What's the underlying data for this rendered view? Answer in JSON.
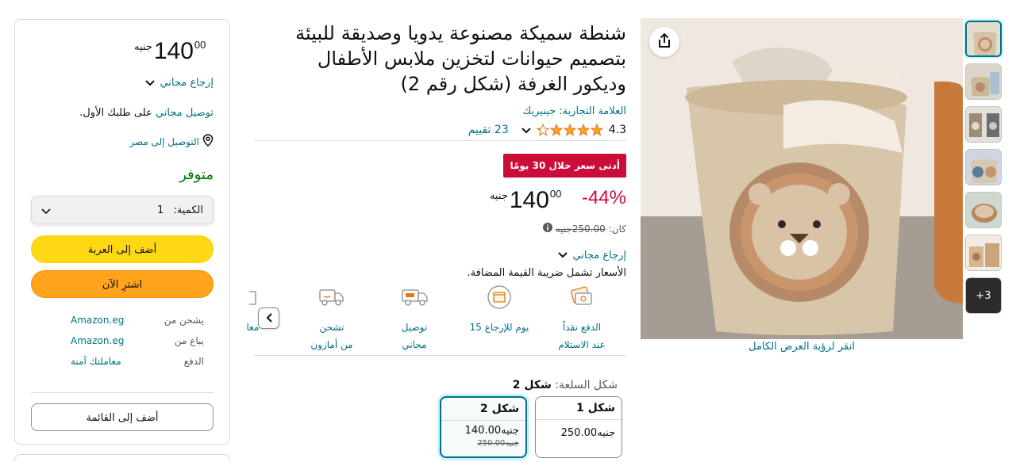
{
  "buybox": {
    "price": {
      "whole": "140",
      "fraction": "00",
      "currency": "جنيه"
    },
    "free_returns": "إرجاع مجاني",
    "free_delivery": {
      "link": "توصيل مجاني",
      "rest": "على طلبك الأول."
    },
    "deliver_to": "التوصيل إلى مصر",
    "availability": "متوفر",
    "quantity": {
      "label": "الكمية:",
      "value": "1"
    },
    "add_to_cart": "أضف إلى العربة",
    "buy_now": "اشترِ الآن",
    "ships_from": {
      "label": "يشحن من",
      "value": "Amazon.eg"
    },
    "sold_by": {
      "label": "يباع من",
      "value": "Amazon.eg"
    },
    "payment": {
      "label": "الدفع",
      "value": "معاملتك آمنة"
    },
    "add_to_list": "أضف إلى القائمة"
  },
  "product": {
    "title_lines": [
      "شنطة سميكة مصنوعة يدويا وصديقة للبيئة",
      "بتصميم حيوانات لتخزين ملابس الأطفال",
      "وديكور الغرفة (شكل رقم 2)"
    ],
    "brand": "العلامة التجارية: جينيريك",
    "rating": "4.3",
    "rating_stars": 4.3,
    "reviews": "23 تقييم",
    "deal_badge": "أدنى سعر خلال 30 يومًا",
    "discount": "-44%",
    "price": {
      "whole": "140",
      "fraction": "00",
      "currency": "جنيه"
    },
    "was": {
      "label": "كان:",
      "value": "250.00جنيه"
    },
    "free_returns": "إرجاع مجاني",
    "vat_note": ".الأسعار تشمل ضريبة القيمة المضافة",
    "features": [
      {
        "line1": "الدفع نقداً",
        "line2": "عند الاستلام"
      },
      {
        "line1": "15 يوم للإرجاع",
        "line2": ""
      },
      {
        "line1": "توصيل",
        "line2": "مجاني"
      },
      {
        "line1": "تشحن",
        "line2": "من أمازون"
      },
      {
        "line1": "معاملة",
        "line2": ""
      }
    ],
    "variant": {
      "label": "شكل السلعة:",
      "selected": "شكل 2",
      "options": [
        {
          "name": "شكل 1",
          "price": "250.00جنيه",
          "old": ""
        },
        {
          "name": "شكل 2",
          "price": "140.00جنيه",
          "old": "250.00جنيه"
        }
      ]
    }
  },
  "gallery": {
    "view_full": "انقر لرؤية العرض الكامل",
    "more_count": "+3"
  }
}
